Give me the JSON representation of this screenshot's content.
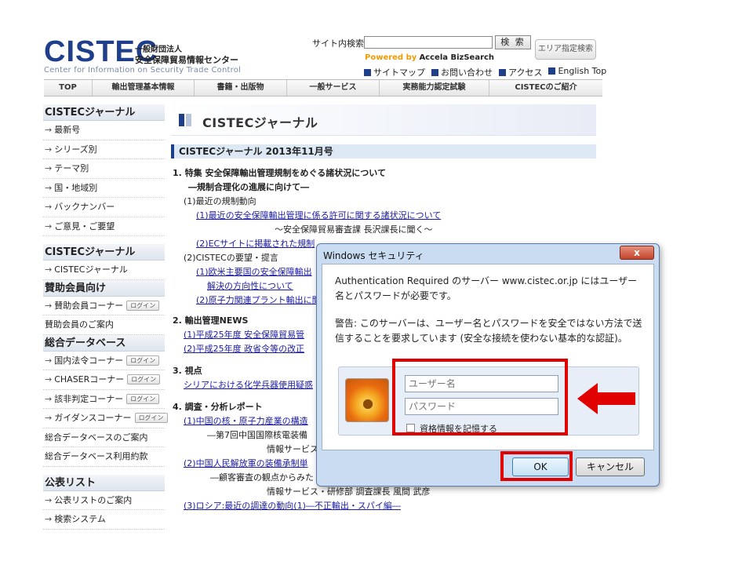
{
  "header": {
    "logo_mark": "CISTEC",
    "logo_sub1": "一般財団法人",
    "logo_sub2": "安全保障貿易情報センター",
    "logo_en": "Center for Information on Security Trade Control",
    "search_label": "サイト内検索",
    "search_value": "",
    "search_button": "検 索",
    "area_search_button": "エリア指定検索",
    "powered_by": "Powered by",
    "powered_name": "Accela BizSearch",
    "utility_links": [
      "サイトマップ",
      "お問い合わせ",
      "アクセス",
      "English Top"
    ]
  },
  "nav": [
    "TOP",
    "輸出管理基本情報",
    "書籍・出版物",
    "一般サービス",
    "実務能力認定試験",
    "CISTECのご紹介"
  ],
  "sidebar": {
    "sections": [
      {
        "title": "CISTECジャーナル",
        "items": [
          "最新号",
          "シリーズ別",
          "テーマ別",
          "国・地域別",
          "バックナンバー",
          "ご意見・ご要望"
        ]
      },
      {
        "title": "CISTECジャーナル",
        "items": [
          "CISTECジャーナル"
        ]
      },
      {
        "title": "賛助会員向け",
        "items": [
          "賛助会員コーナー",
          "賛助会員のご案内"
        ]
      },
      {
        "title": "総合データベース",
        "items": [
          "国内法令コーナー",
          "CHASERコーナー",
          "該非判定コーナー",
          "ガイダンスコーナー",
          "総合データベースのご案内",
          "総合データベース利用約款"
        ]
      },
      {
        "title": "公表リスト",
        "items": [
          "公表リストのご案内",
          "検索システム"
        ]
      }
    ],
    "login_label": "ログイン"
  },
  "main": {
    "page_title": "CISTECジャーナル",
    "issue_title": "CISTECジャーナル 2013年11月号",
    "lines": [
      "1. 特集 安全保障輸出管理規制をめぐる諸状況について",
      "―規制合理化の進展に向けて―",
      "(1)最近の規制動向",
      "(1)最近の安全保障輸出管理に係る許可に関する諸状況について",
      "～安全保障貿易審査課 長沢課長に聞く～",
      "(2)ECサイトに掲載された規制",
      "(2)CISTECの要望・提言",
      "(1)欧米主要国の安全保障輸出",
      "解決の方向性について",
      "(2)原子力関連プラント輸出に関",
      "2. 輸出管理NEWS",
      "(1)平成25年度 安全保障貿易管",
      "(2)平成25年度 政省令等の改正",
      "3. 視点",
      "シリアにおける化学兵器使用疑惑",
      "4. 調査・分析レポート",
      "(1)中国の核・原子力産業の構造",
      "―第7回中国国際核電装備",
      "情報サービス",
      "(2)中国人民解放軍の装備承制単",
      "―顧客審査の観点からみた",
      "情報サービス・研修部 調査課長 風間 武彦",
      "(3)ロシア:最近の調達の動向(1)―不正輸出・スパイ編―"
    ]
  },
  "dialog": {
    "title": "Windows セキュリティ",
    "close_label": "x",
    "message": "Authentication Required のサーバー www.cistec.or.jp にはユーザー名とパスワードが必要です。",
    "warning": "警告: このサーバーは、ユーザー名とパスワードを安全ではない方法で送信することを要求しています (安全な接続を使わない基本的な認証)。",
    "username_placeholder": "ユーザー名",
    "password_placeholder": "パスワード",
    "remember_label": "資格情報を記憶する",
    "ok_label": "OK",
    "cancel_label": "キャンセル"
  },
  "colors": {
    "brand": "#1f3f8a",
    "highlight": "#e00000",
    "dialog_frame": "#c9dcf2",
    "link": "#1a1aa6"
  }
}
